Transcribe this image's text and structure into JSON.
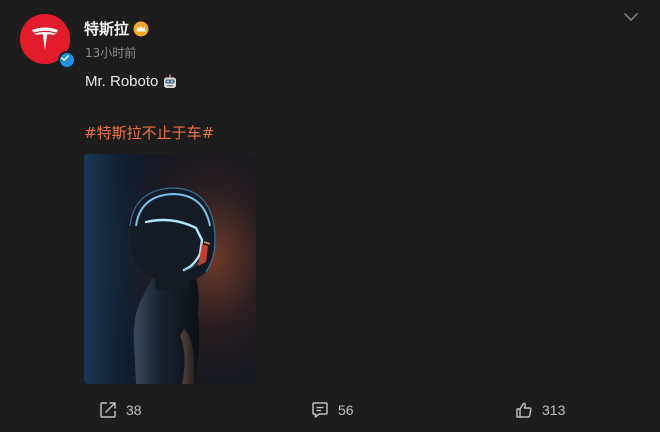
{
  "post": {
    "author": {
      "name": "特斯拉",
      "avatar_icon": "tesla-logo-icon",
      "avatar_color": "#e31c2c",
      "verified_icon": "verified-badge-icon",
      "member_icon": "crown-icon"
    },
    "timestamp": "13小时前",
    "text": "Mr. Roboto",
    "text_emoji": "robot-face-icon",
    "hashtag": "#特斯拉不止于车#",
    "hashtag_color": "#eb7340",
    "media": {
      "description_icon": "robot-silhouette-image"
    },
    "actions": {
      "repost_count": "38",
      "comment_count": "56",
      "like_count": "313"
    }
  }
}
